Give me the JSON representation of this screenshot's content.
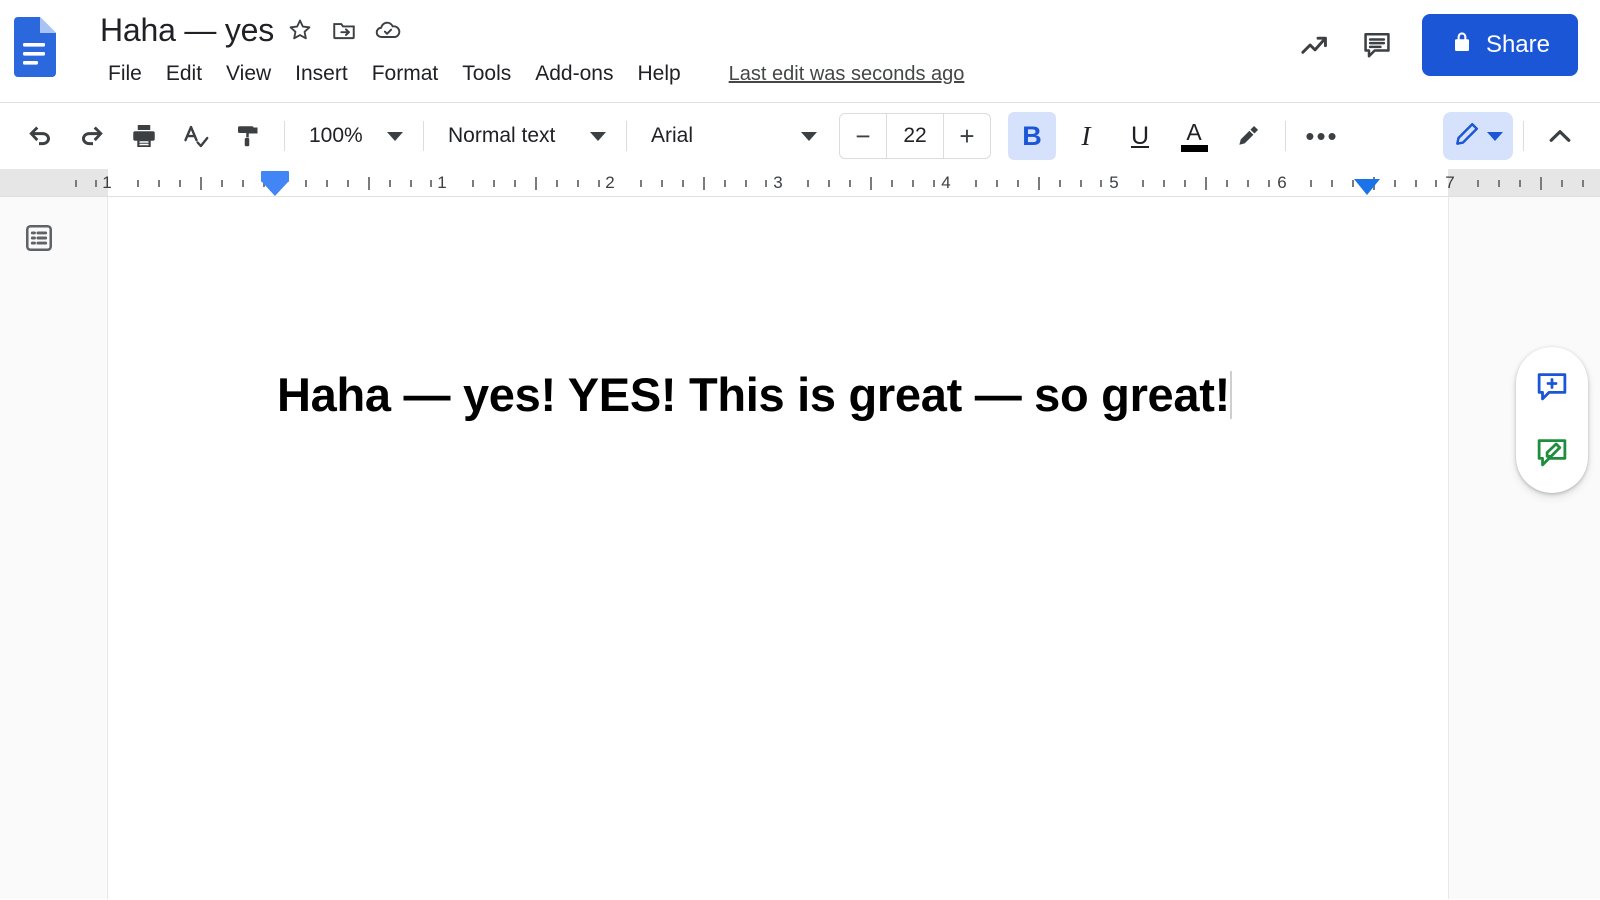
{
  "header": {
    "logo_icon": "google-docs-logo-icon",
    "doc_title": "Haha — yes",
    "title_icons": [
      {
        "name": "star-icon",
        "tooltip": "Star"
      },
      {
        "name": "move-to-folder-icon",
        "tooltip": "Move"
      },
      {
        "name": "cloud-saved-icon",
        "tooltip": "See document status"
      }
    ],
    "menus": [
      "File",
      "Edit",
      "View",
      "Insert",
      "Format",
      "Tools",
      "Add-ons",
      "Help"
    ],
    "last_edit": "Last edit was seconds ago",
    "right_icons": [
      {
        "name": "activity-dashboard-icon",
        "tooltip": "Open activity dashboard"
      },
      {
        "name": "comment-history-icon",
        "tooltip": "Open comment history"
      }
    ],
    "share_label": "Share",
    "share_lock_icon": "lock-icon",
    "share_color": "#1b56d6"
  },
  "toolbar": {
    "undo_icon": "undo-icon",
    "redo_icon": "redo-icon",
    "print_icon": "print-icon",
    "spellcheck_icon": "spellcheck-icon",
    "paint_format_icon": "paint-format-icon",
    "zoom_value": "100%",
    "style_value": "Normal text",
    "font_value": "Arial",
    "font_size_value": "22",
    "decrease_font_label": "−",
    "increase_font_label": "+",
    "bold_label": "B",
    "bold_active": true,
    "italic_label": "I",
    "underline_label": "U",
    "text_color_label": "A",
    "text_color_swatch": "#000000",
    "highlight_icon": "highlight-pen-icon",
    "more_label": "•••",
    "mode_icon": "edit-pencil-icon",
    "mode_active_color": "#1b56d6",
    "collapse_icon": "chevron-up-icon"
  },
  "ruler": {
    "numbers": [
      "1",
      "1",
      "2",
      "3",
      "4",
      "5",
      "6",
      "7"
    ],
    "left_indent_icon": "left-indent-marker",
    "right_indent_icon": "right-indent-marker"
  },
  "document": {
    "outline_icon": "document-outline-icon",
    "body_text": "Haha — yes! YES! This is great — so great!"
  },
  "float_buttons": [
    {
      "name": "add-comment-icon",
      "color": "#1b56d6"
    },
    {
      "name": "suggest-edit-icon",
      "color": "#1e8e3e"
    }
  ]
}
